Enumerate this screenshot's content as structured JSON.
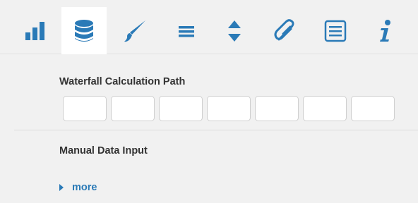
{
  "tabs": [
    {
      "icon": "bar-chart-icon",
      "active": false
    },
    {
      "icon": "database-icon",
      "active": true
    },
    {
      "icon": "brush-icon",
      "active": false
    },
    {
      "icon": "menu-lines-icon",
      "active": false
    },
    {
      "icon": "sort-arrows-icon",
      "active": false
    },
    {
      "icon": "paperclip-icon",
      "active": false
    },
    {
      "icon": "list-icon",
      "active": false
    },
    {
      "icon": "info-icon",
      "active": false
    }
  ],
  "colors": {
    "accent": "#2a7ab7",
    "background": "#f1f1f1"
  },
  "waterfall": {
    "title": "Waterfall Calculation Path",
    "path_values": [
      "",
      "",
      "",
      "",
      "",
      "",
      ""
    ]
  },
  "manual_data": {
    "title": "Manual Data Input",
    "more_label": "more"
  }
}
